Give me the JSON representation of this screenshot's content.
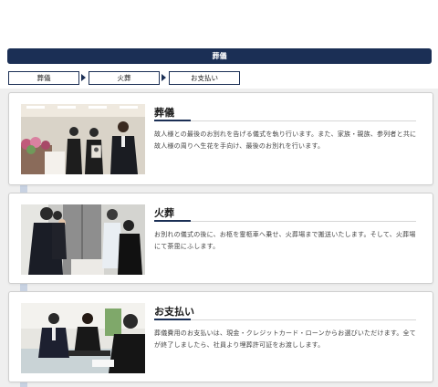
{
  "header": {
    "title": "葬儀"
  },
  "steps": [
    {
      "label": "葬儀"
    },
    {
      "label": "火葬"
    },
    {
      "label": "お支払い"
    }
  ],
  "sections": [
    {
      "title": "葬儀",
      "description": "故人様との最後のお別れを告げる儀式を執り行います。また、家族・親族、参列者と共に故人様の周りへ生花を手向け、最後のお別れを行います。"
    },
    {
      "title": "火葬",
      "description": "お別れの儀式の後に、お柩を霊柩車へ乗せ、火葬場まで搬送いたします。そして、火葬場にて荼毘にふします。"
    },
    {
      "title": "お支払い",
      "description": "葬儀費用のお支払いは、現金・クレジットカード・ローンからお選びいただけます。全てが終了しましたら、社員より埋葬許可証をお渡しします。"
    }
  ],
  "colors": {
    "navy": "#1b2f55",
    "accent_light": "#c8d2e2",
    "background": "#efefef"
  }
}
